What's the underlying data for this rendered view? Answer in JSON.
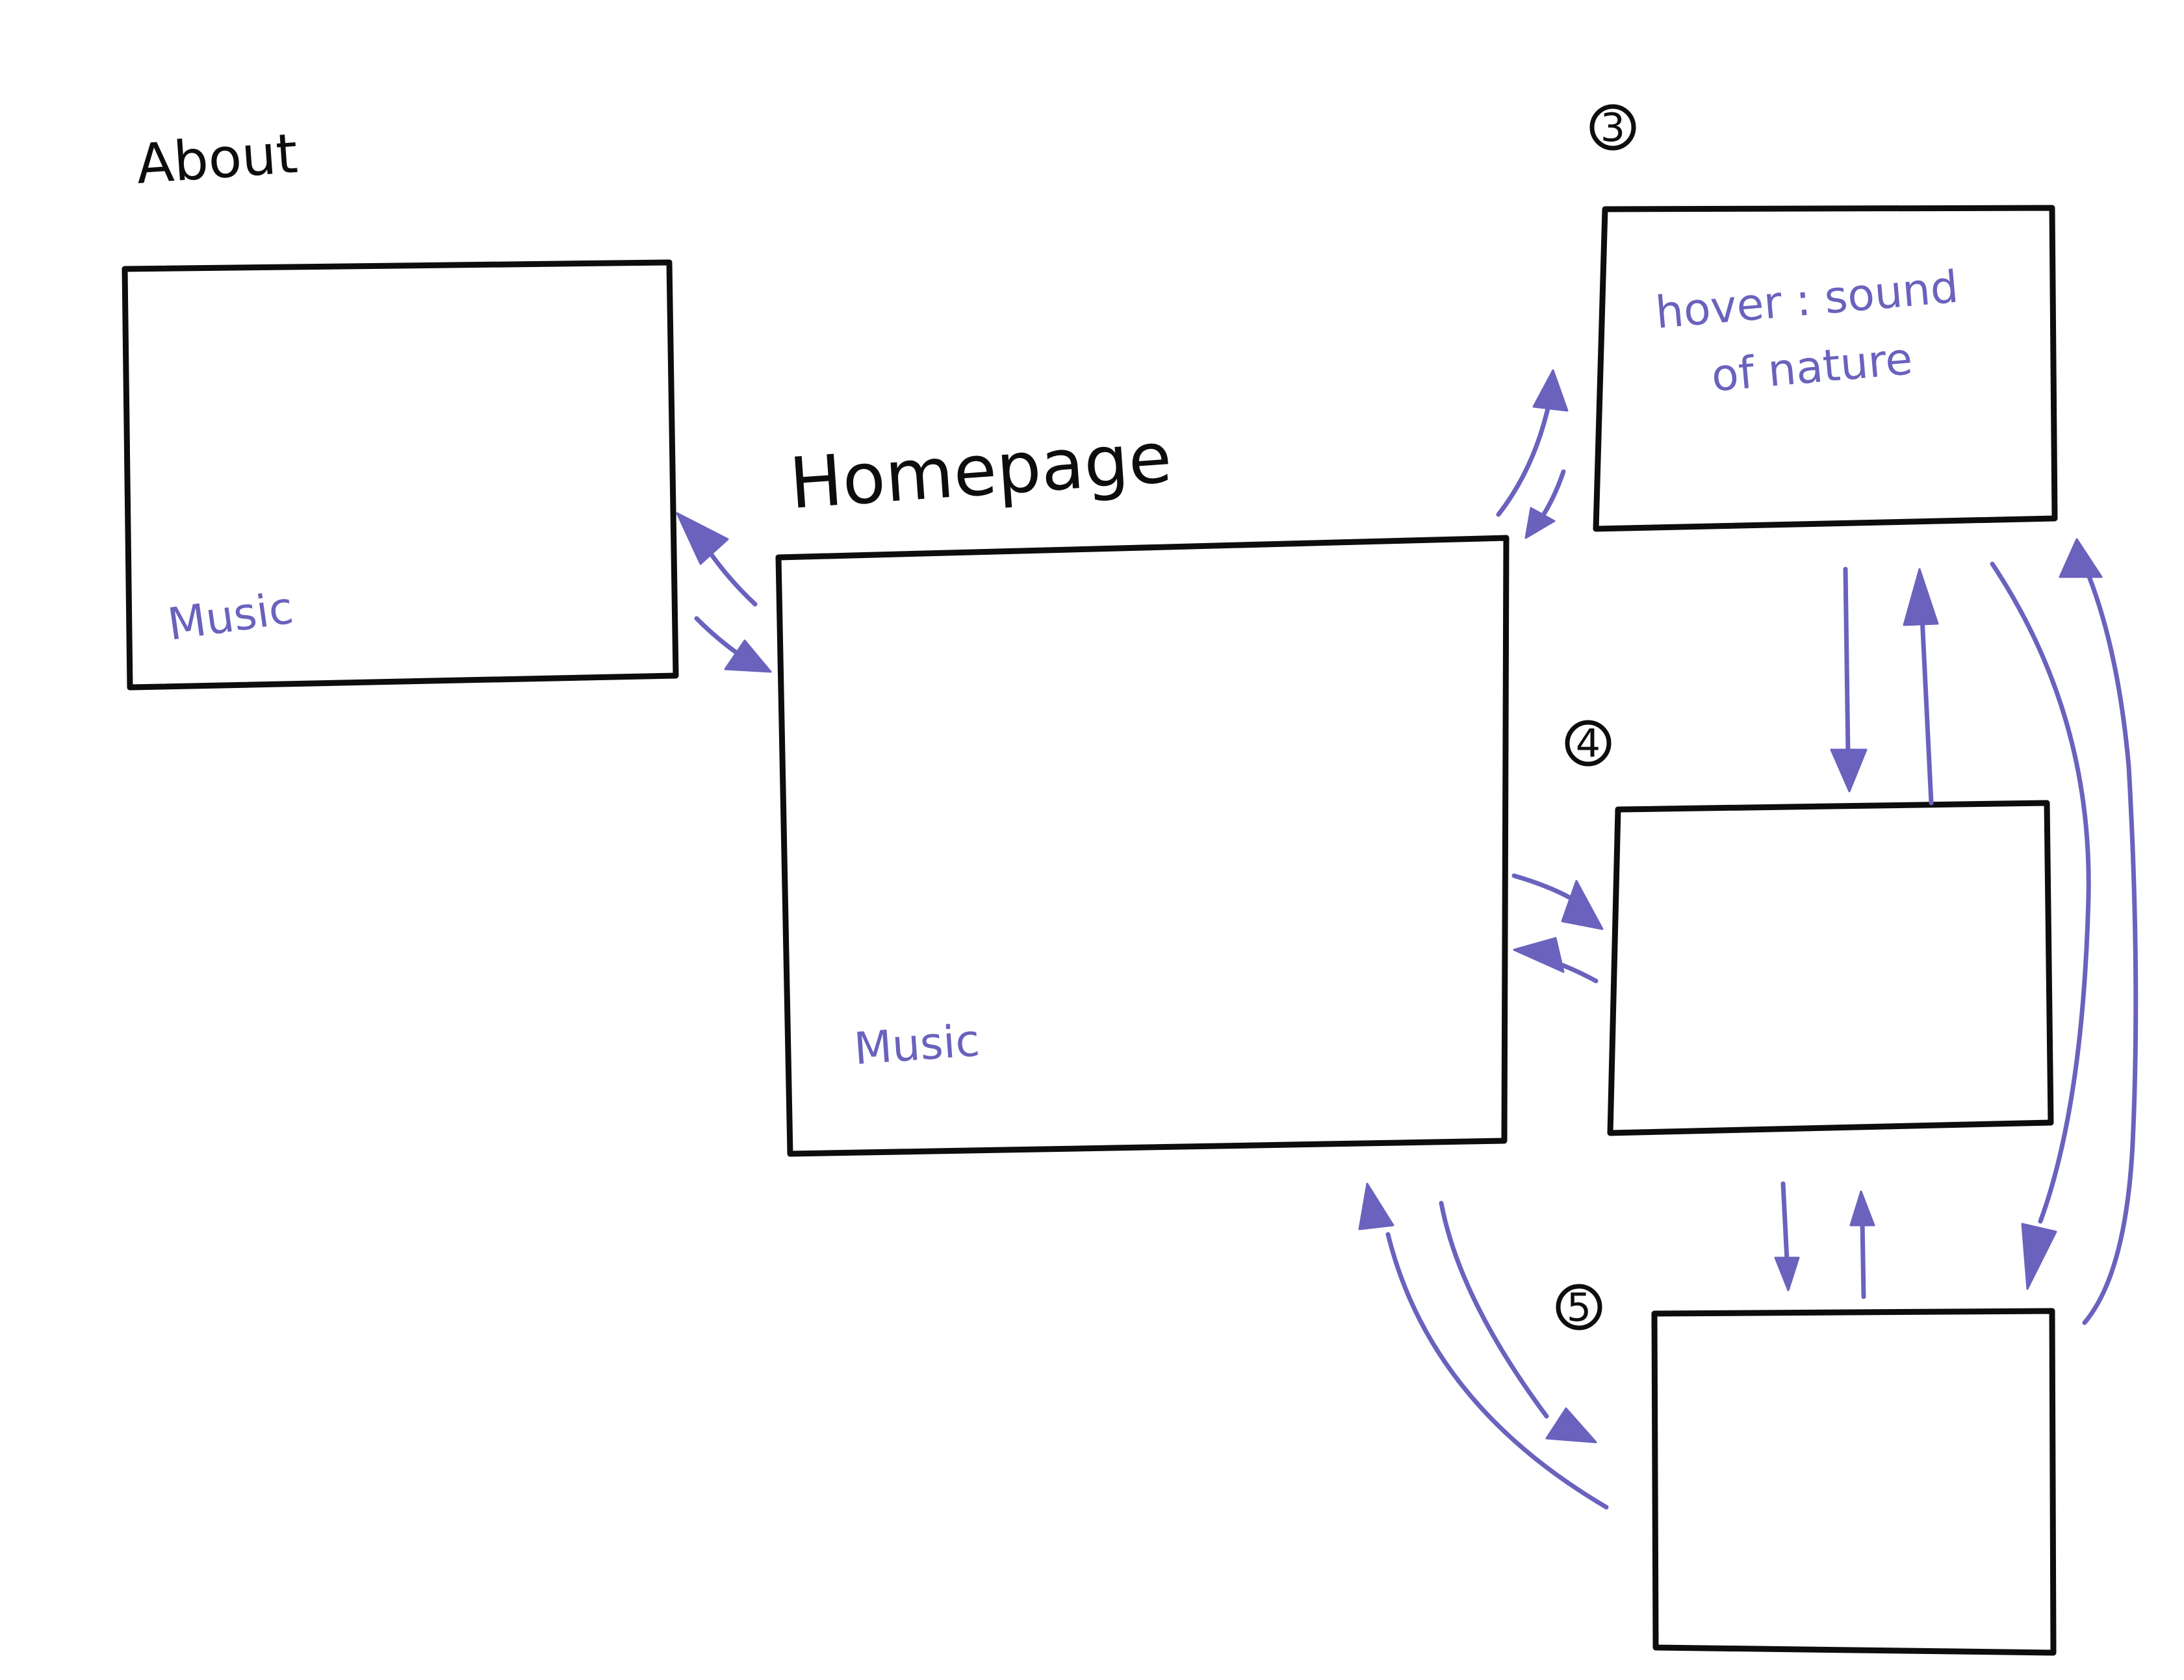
{
  "diagram": {
    "colors": {
      "frame": "#0d0d0d",
      "annotation": "#6a62bd",
      "background": "#ffffff"
    },
    "frames": {
      "about": {
        "title": "About",
        "note": "Music"
      },
      "homepage": {
        "title": "Homepage",
        "note": "Music"
      },
      "page3": {
        "number": "3",
        "note_line1": "hover : sound",
        "note_line2": "of nature"
      },
      "page4": {
        "number": "4"
      },
      "page5": {
        "number": "5"
      }
    },
    "connections": [
      {
        "from": "homepage",
        "to": "about"
      },
      {
        "from": "about",
        "to": "homepage"
      },
      {
        "from": "homepage",
        "to": "page3"
      },
      {
        "from": "page3",
        "to": "homepage"
      },
      {
        "from": "homepage",
        "to": "page4"
      },
      {
        "from": "page4",
        "to": "homepage"
      },
      {
        "from": "homepage",
        "to": "page5"
      },
      {
        "from": "page5",
        "to": "homepage"
      },
      {
        "from": "page3",
        "to": "page4"
      },
      {
        "from": "page4",
        "to": "page3"
      },
      {
        "from": "page4",
        "to": "page5"
      },
      {
        "from": "page5",
        "to": "page4"
      },
      {
        "from": "page3",
        "to": "page5"
      },
      {
        "from": "page5",
        "to": "page3"
      }
    ]
  }
}
